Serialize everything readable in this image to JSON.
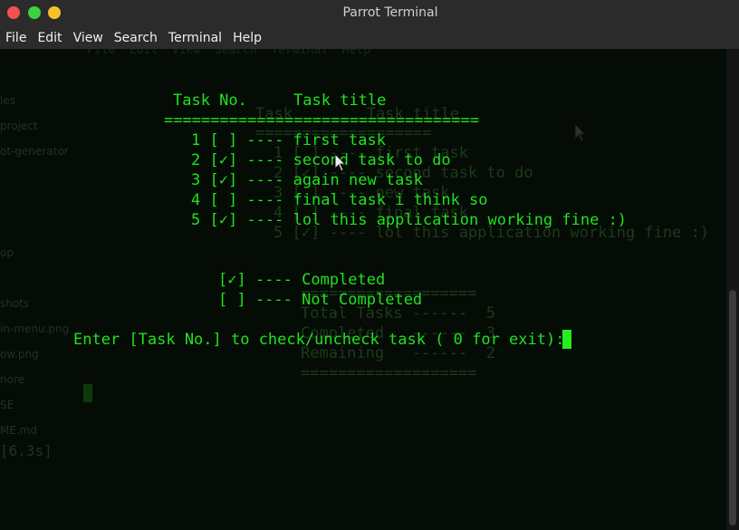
{
  "window": {
    "title": "Parrot Terminal",
    "close_color": "#f0524f",
    "minimize_color": "#3bd140",
    "maximize_color": "#f6c22b"
  },
  "menu": [
    "File",
    "Edit",
    "View",
    "Search",
    "Terminal",
    "Help"
  ],
  "terminal": {
    "header": "Task No.     Task title",
    "separator": "==================================",
    "tasks": [
      "1 [ ] ---- first task",
      "2 [✓] ---- second task to do",
      "3 [✓] ---- again new task",
      "4 [ ] ---- final task i think so",
      "5 [✓] ---- lol this application working fine :)"
    ],
    "legend": [
      "[✓] ---- Completed",
      "[ ] ---- Not Completed"
    ],
    "prompt": "Enter [Task No.] to check/uncheck task ( 0 for exit): ",
    "text_color": "#1fe21f",
    "background": "#050c05"
  },
  "ghost": {
    "menu": "File  Edit  View  Search  Terminal  Help",
    "title": "Task        Task title",
    "line1": "1 [ ] ---- first task",
    "line2": "2 [✓] ---- second task to do",
    "line3": "3 [ ] ---- new task",
    "line4": "4 [ ] ---- final task",
    "line5": "5 [✓] ---- lol this application working fine :)",
    "sep": "===================",
    "total": "Total Tasks ------  5",
    "done": "Completed   ------  3",
    "remaining": "Remaining   ------  2",
    "sidebar": [
      "les",
      "project",
      "ot-generator",
      "op",
      "shots",
      "in-menu.png",
      "ow.png",
      "nore",
      "SE",
      "ME.md"
    ],
    "timer": "[6.3s]"
  }
}
